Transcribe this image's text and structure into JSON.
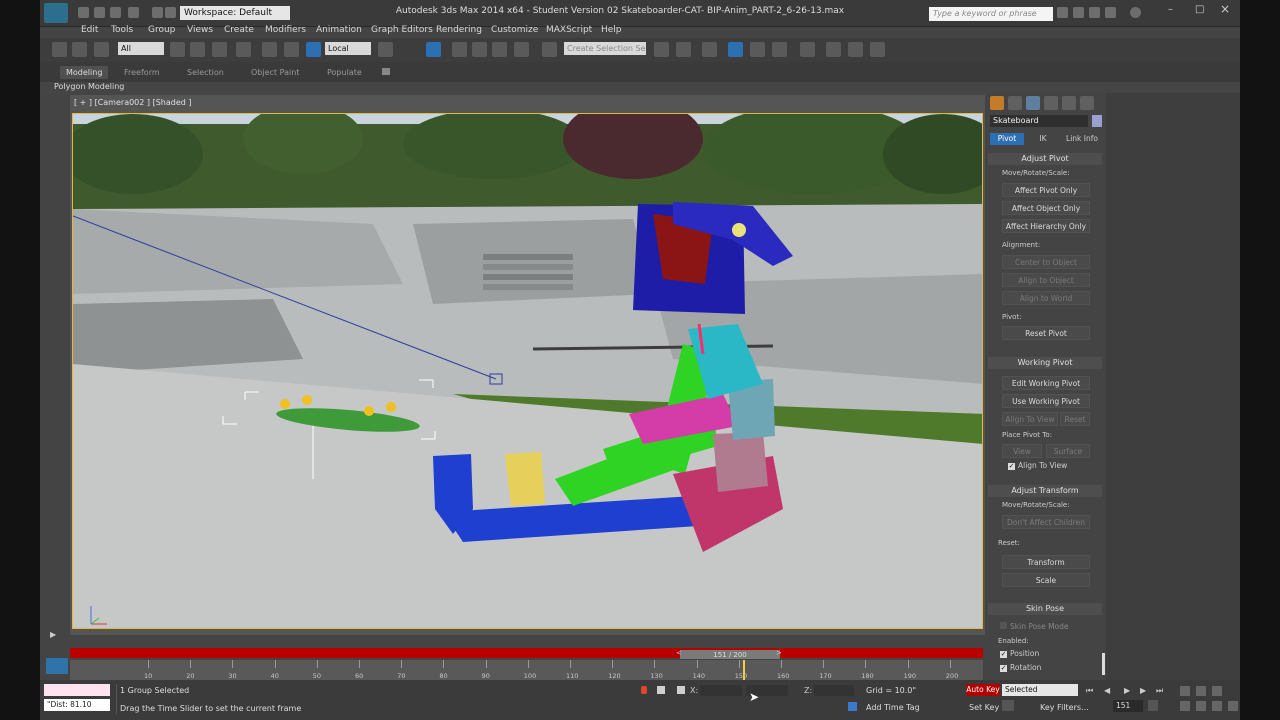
{
  "titlebar": {
    "workspace": "Workspace: Default",
    "title": "Autodesk 3ds Max 2014 x64 - Student Version    02 Skateboarder-CAT- BIP-Anim_PART-2_6-26-13.max",
    "search_placeholder": "Type a keyword or phrase"
  },
  "menubar": [
    "Edit",
    "Tools",
    "Group",
    "Views",
    "Create",
    "Modifiers",
    "Animation",
    "Graph Editors",
    "Rendering",
    "Customize",
    "MAXScript",
    "Help"
  ],
  "toolbar": {
    "filter": "All",
    "coord": "Local",
    "selection_set_placeholder": "Create Selection Se"
  },
  "ribbon": {
    "tabs": [
      "Modeling",
      "Freeform",
      "Selection",
      "Object Paint",
      "Populate"
    ],
    "sub": "Polygon Modeling"
  },
  "viewport": {
    "label": "[ + ] [Camera002 ] [Shaded ]"
  },
  "command_panel": {
    "object_name": "Skateboard",
    "tabs": [
      "Pivot",
      "IK",
      "Link Info"
    ],
    "adjust_pivot": {
      "title": "Adjust Pivot",
      "move_label": "Move/Rotate/Scale:",
      "buttons": [
        "Affect Pivot Only",
        "Affect Object Only",
        "Affect Hierarchy Only"
      ],
      "alignment_label": "Alignment:",
      "align_buttons": [
        "Center to Object",
        "Align to Object",
        "Align to World"
      ],
      "pivot_label": "Pivot:",
      "reset_pivot": "Reset Pivot"
    },
    "working_pivot": {
      "title": "Working Pivot",
      "buttons": [
        "Edit Working Pivot",
        "Use Working Pivot"
      ],
      "align_view": "Align To View",
      "reset": "Reset",
      "place_label": "Place Pivot To:",
      "view": "View",
      "surface": "Surface",
      "align_to_view_check": "Align To View"
    },
    "adjust_transform": {
      "title": "Adjust Transform",
      "move_label": "Move/Rotate/Scale:",
      "dont_affect": "Don't Affect Children",
      "reset_label": "Reset:",
      "transform": "Transform",
      "scale": "Scale"
    },
    "skin_pose": {
      "title": "Skin Pose",
      "mode": "Skin Pose Mode",
      "enabled": "Enabled:",
      "position": "Position",
      "rotation": "Rotation"
    }
  },
  "timeline": {
    "slider": "151 / 200",
    "ticks": [
      "10",
      "20",
      "30",
      "40",
      "50",
      "60",
      "70",
      "80",
      "90",
      "100",
      "110",
      "120",
      "130",
      "140",
      "150",
      "160",
      "170",
      "180",
      "190",
      "200"
    ],
    "current_frame_fraction": 0.755
  },
  "status": {
    "listener": "\"Dist: 81.10",
    "selection": "1 Group Selected",
    "hint": "Drag the Time Slider to set the current frame",
    "grid": "Grid = 10.0\"",
    "add_time_tag": "Add Time Tag",
    "auto_key": "Auto Key",
    "selected": "Selected",
    "set_key": "Set Key",
    "key_filters": "Key Filters...",
    "frame": "151",
    "x": "X:",
    "z": "Z:"
  }
}
